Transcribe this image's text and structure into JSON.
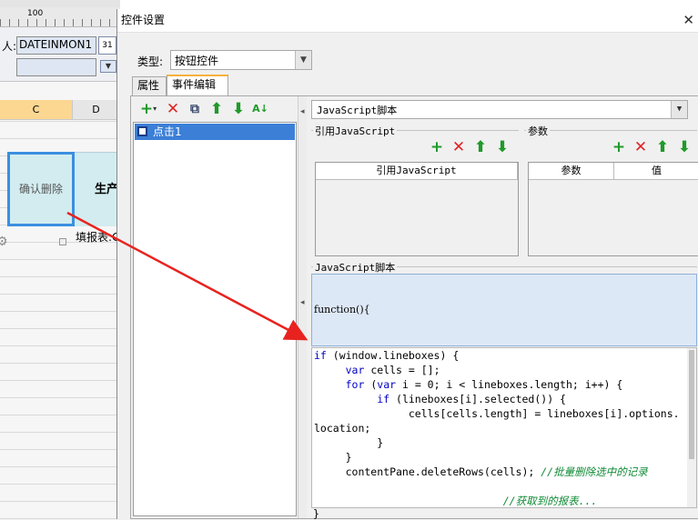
{
  "background": {
    "ruler_number": "100",
    "field_label": "人:",
    "field_value": "DATEINMON1",
    "calendar_badge": "31",
    "columns": [
      "C",
      "D"
    ],
    "button_cell_text": "确认删除",
    "next_cell_text": "生产",
    "below_cell_text": "填报表:C"
  },
  "dialog": {
    "title": "控件设置",
    "type_label": "类型:",
    "type_value": "按钮控件",
    "tabs": [
      {
        "label": "属性"
      },
      {
        "label": "事件编辑"
      }
    ],
    "event_list": [
      {
        "label": "点击1"
      }
    ],
    "script_type": "JavaScript脚本",
    "ref_js_section": "引用JavaScript",
    "params_section": "参数",
    "ref_js_header": "引用JavaScript",
    "params_headers": [
      "参数",
      "值"
    ],
    "script_section": "JavaScript脚本",
    "function_header": "function(){",
    "closing": "}"
  },
  "code_lines": [
    "if (window.lineboxes) {",
    "     var cells = [];",
    "     for (var i = 0; i < lineboxes.length; i++) {",
    "          if (lineboxes[i].selected()) {",
    "               cells[cells.length] = lineboxes[i].options.",
    "location;",
    "          }",
    "     }",
    "     contentPane.deleteRows(cells); //批量删除选中的记录",
    "",
    "                              //获取到的报表..."
  ],
  "colors": {
    "selected_tab_accent": "#f7b13c",
    "list_selection": "#3b7fd7",
    "add_icon": "#1f9a2a",
    "delete_icon": "#e02424",
    "arrow": "#e8231f"
  }
}
